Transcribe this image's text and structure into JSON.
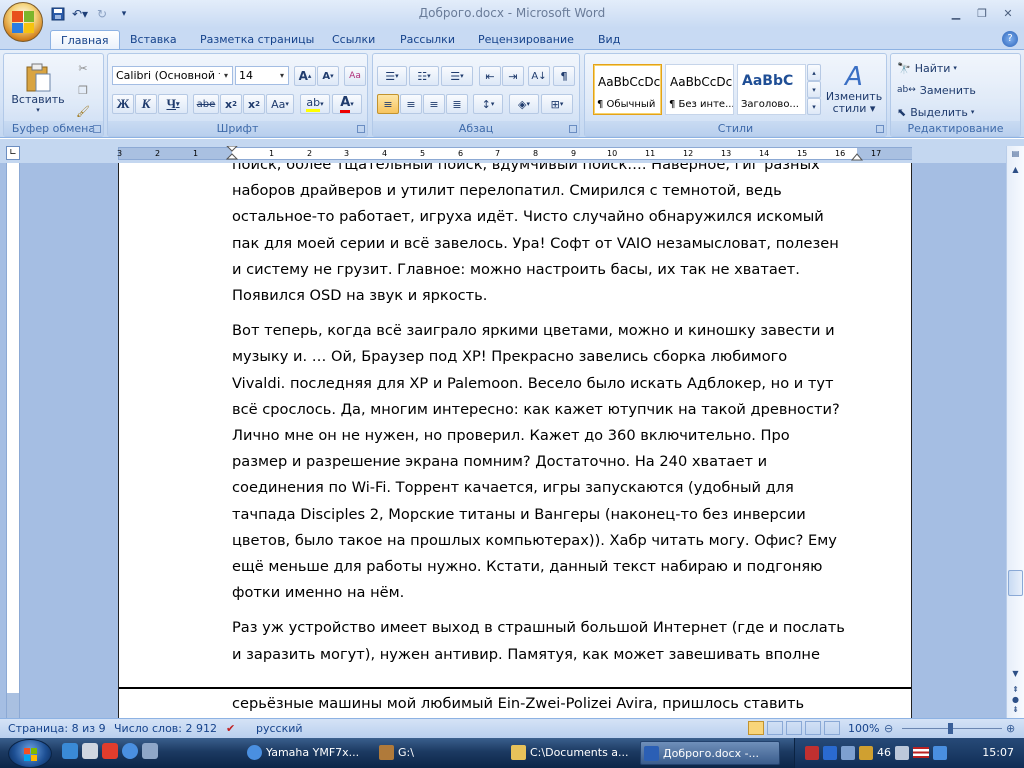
{
  "window": {
    "title": "Доброго.docx - Microsoft Word"
  },
  "tabs": [
    "Главная",
    "Вставка",
    "Разметка страницы",
    "Ссылки",
    "Рассылки",
    "Рецензирование",
    "Вид"
  ],
  "ribbon": {
    "clipboard": {
      "label": "Буфер обмена",
      "paste_label": "Вставить"
    },
    "font": {
      "label": "Шрифт",
      "font_name": "Calibri (Основной те",
      "font_size": "14"
    },
    "paragraph": {
      "label": "Абзац"
    },
    "styles": {
      "label": "Стили",
      "items": [
        {
          "preview": "AaBbCcDc",
          "name": "¶ Обычный"
        },
        {
          "preview": "AaBbCcDc",
          "name": "¶ Без инте..."
        },
        {
          "preview": "AaBbC",
          "name": "Заголово..."
        }
      ],
      "change_line1": "Изменить",
      "change_line2": "стили"
    },
    "editing": {
      "label": "Редактирование",
      "find": "Найти",
      "replace": "Заменить",
      "select": "Выделить"
    }
  },
  "ruler": {
    "labels": [
      "3",
      "2",
      "1",
      "1",
      "2",
      "3",
      "4",
      "5",
      "6",
      "7",
      "8",
      "9",
      "10",
      "11",
      "12",
      "13",
      "14",
      "15",
      "16",
      "17"
    ]
  },
  "document": {
    "paragraphs": [
      [
        "поиск, более тщательный поиск, вдумчивый поиск…. Наверное, гиг разных",
        "наборов драйверов и утилит перелопатил. Смирился с темнотой, ведь",
        "остальное-то работает, игруха идёт. Чисто случайно обнаружился искомый",
        "пак для моей серии и всё завелось. Ура! Софт от VAIO незамысловат, полезен",
        "и систему не грузит. Главное:  можно настроить басы, их так не хватает.",
        "Появился OSD на звук и яркость."
      ],
      [
        "Вот теперь, когда всё заиграло яркими цветами, можно и киношку завести и",
        "музыку и. … Ой, Браузер под XP! Прекрасно завелись сборка любимого",
        "Vivaldi. последняя для XP и Palemoon. Весело было искать Адблокер, но и тут",
        "всё срослось. Да, многим интересно: как кажет ютупчик на такой древности?",
        "Лично мне он не нужен, но проверил. Кажет до 360 включительно. Про",
        "размер и разрешение экрана помним? Достаточно. На 240 хватает и",
        "соединения по Wi-Fi. Торрент качается, игры запускаются (удобный для",
        "тачпада Disciples 2, Морские титаны и Вангеры (наконец-то без инверсии",
        "цветов, было такое на прошлых компьютерах)). Хабр читать могу. Офис? Ему",
        "ещё меньше для работы нужно. Кстати, данный текст набираю и подгоняю",
        "фотки именно на нём."
      ],
      [
        "Раз уж устройство имеет выход в страшный большой Интернет (где и послать",
        "и заразить могут), нужен антивир. Памятуя, как может завешивать вполне"
      ]
    ],
    "next_page_line": "серьёзные машины мой любимый Ein-Zwei-Polizei Avira, пришлось ставить"
  },
  "status": {
    "page": "Страница: 8 из 9",
    "words": "Число слов: 2 912",
    "language": "русский",
    "zoom": "100%"
  },
  "taskbar": {
    "items": [
      "Yamaha YMF7x...",
      "G:\\",
      "C:\\Documents a...",
      "Доброго.docx -..."
    ],
    "tray_number": "46",
    "clock": "15:07"
  }
}
